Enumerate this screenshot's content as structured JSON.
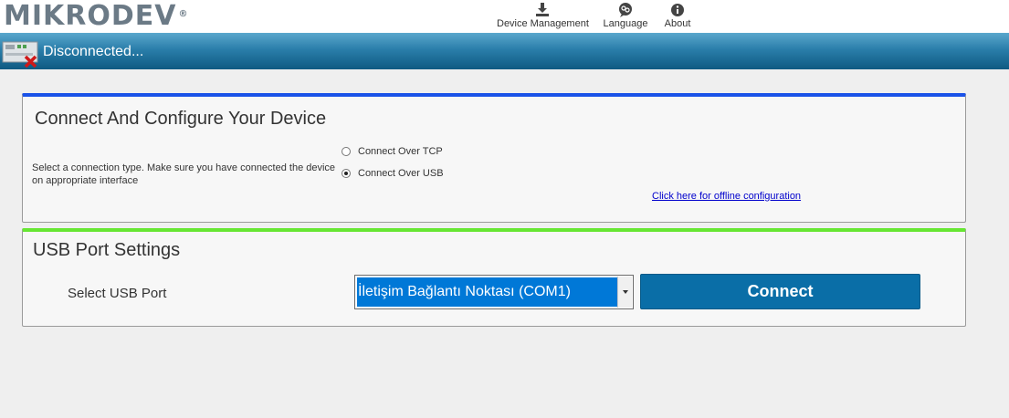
{
  "header": {
    "logo_text": "MIKRODEV",
    "logo_mark": "®",
    "nav": [
      {
        "label": "Device Management",
        "icon": "download-icon"
      },
      {
        "label": "Language",
        "icon": "language-icon"
      },
      {
        "label": "About",
        "icon": "info-icon"
      }
    ]
  },
  "status": {
    "text": "Disconnected...",
    "icon": "device-disconnected-icon"
  },
  "connect_panel": {
    "title": "Connect And Configure Your Device",
    "hint": "Select a connection type. Make sure you have connected the device on appropriate interface",
    "options": [
      {
        "label": "Connect Over TCP",
        "selected": false
      },
      {
        "label": "Connect Over USB",
        "selected": true
      }
    ],
    "offline_link": "Click here for offline configuration"
  },
  "usb_panel": {
    "title": "USB Port Settings",
    "port_label": "Select USB Port",
    "selected_port": "İletişim Bağlantı Noktası (COM1)",
    "connect_label": "Connect"
  },
  "colors": {
    "connect_accent": "#1a52e8",
    "usb_accent": "#66e632",
    "button": "#0a6ea7",
    "status_bar": "#2a7eaa"
  }
}
